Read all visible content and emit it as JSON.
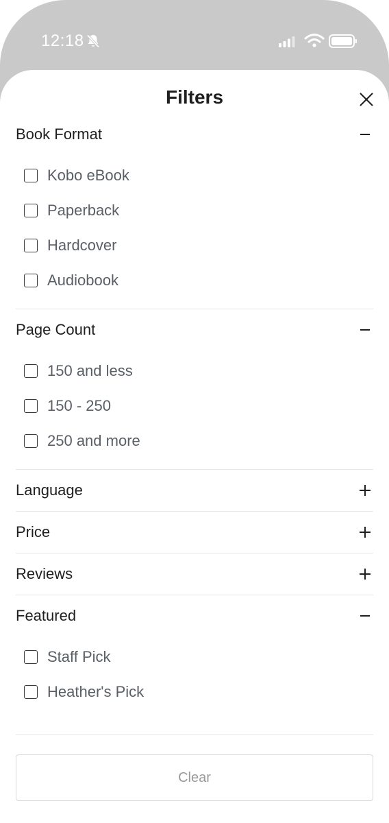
{
  "status_bar": {
    "time": "12:18",
    "icons": [
      "bell-slash-icon",
      "signal-icon",
      "wifi-icon",
      "battery-icon"
    ]
  },
  "sheet": {
    "title": "Filters",
    "close_icon": "close-icon"
  },
  "sections": [
    {
      "title": "Book Format",
      "expanded": true,
      "options": [
        "Kobo eBook",
        "Paperback",
        "Hardcover",
        "Audiobook"
      ]
    },
    {
      "title": "Page Count",
      "expanded": true,
      "options": [
        "150 and less",
        "150 - 250",
        "250 and more"
      ]
    },
    {
      "title": "Language",
      "expanded": false,
      "options": []
    },
    {
      "title": "Price",
      "expanded": false,
      "options": []
    },
    {
      "title": "Reviews",
      "expanded": false,
      "options": []
    },
    {
      "title": "Featured",
      "expanded": true,
      "options": [
        "Staff Pick",
        "Heather's Pick"
      ]
    }
  ],
  "footer": {
    "clear_label": "Clear"
  },
  "colors": {
    "background_top": "#c9c9c9",
    "text_primary": "#1f1f1f",
    "text_option": "#5a5f66",
    "divider": "#e6e6e6",
    "clear_text": "#9a9a9a"
  }
}
